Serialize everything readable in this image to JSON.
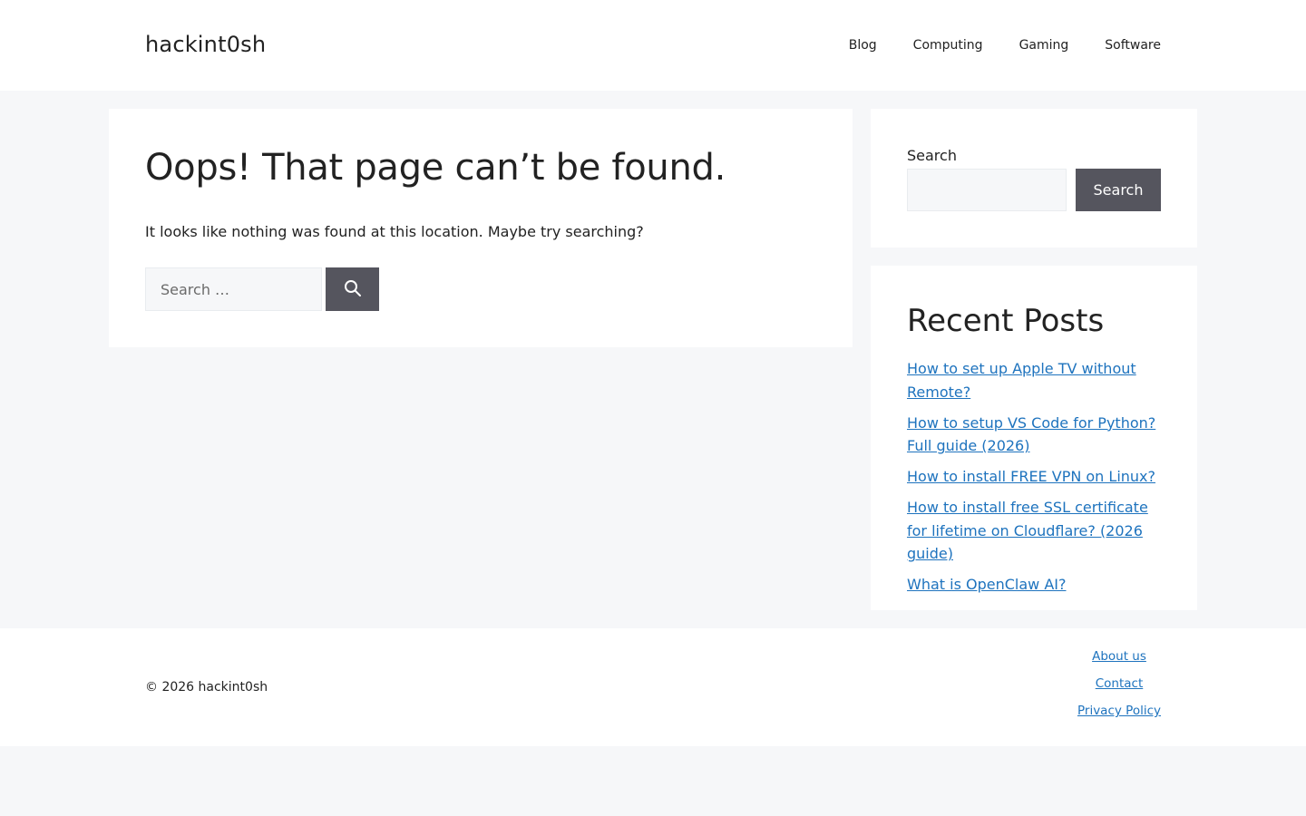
{
  "header": {
    "site_title": "hackint0sh",
    "nav": [
      {
        "label": "Blog"
      },
      {
        "label": "Computing"
      },
      {
        "label": "Gaming"
      },
      {
        "label": "Software"
      }
    ]
  },
  "main": {
    "title": "Oops! That page can’t be found.",
    "description": "It looks like nothing was found at this location. Maybe try searching?",
    "search": {
      "placeholder": "Search …",
      "button_icon": "search-icon"
    }
  },
  "sidebar": {
    "search_widget": {
      "label": "Search",
      "button_label": "Search",
      "input_value": ""
    },
    "recent_posts": {
      "title": "Recent Posts",
      "items": [
        {
          "label": "How to set up Apple TV without Remote?"
        },
        {
          "label": "How to setup VS Code for Python? Full guide (2026)"
        },
        {
          "label": "How to install FREE VPN on Linux?"
        },
        {
          "label": "How to install free SSL certificate for lifetime on Cloudflare? (2026 guide)"
        },
        {
          "label": "What is OpenClaw AI?"
        }
      ]
    }
  },
  "footer": {
    "copyright": "© 2026 hackint0sh",
    "links": [
      {
        "label": "About us"
      },
      {
        "label": "Contact"
      },
      {
        "label": "Privacy Policy"
      }
    ]
  },
  "colors": {
    "background": "#f6f7f9",
    "surface": "#ffffff",
    "button": "#55555e",
    "link": "#1e73be",
    "text": "#222222"
  }
}
